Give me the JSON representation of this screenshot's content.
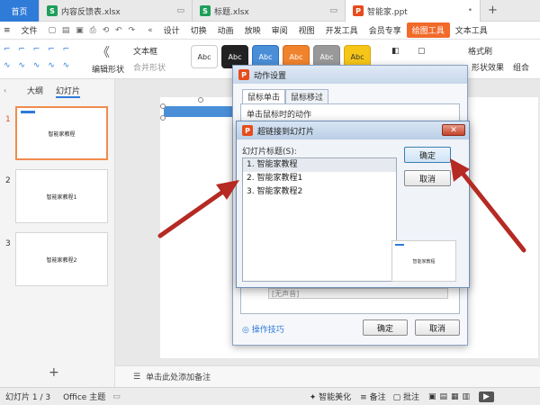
{
  "tabs": {
    "home": "首页",
    "file1": "内容反馈表.xlsx",
    "file2": "标题.xlsx",
    "file3": "智能家.ppt"
  },
  "menu": {
    "file": "文件",
    "items": [
      "设计",
      "切换",
      "动画",
      "放映",
      "审阅",
      "视图",
      "开发工具",
      "会员专享"
    ],
    "drawing_tools": "绘图工具",
    "text_tools": "文本工具"
  },
  "ribbon": {
    "edit_shape": "编辑形状",
    "text_box": "文本框",
    "merge_shape": "合并形状",
    "style_label": "Abc",
    "format_painter": "格式刷",
    "fill": "填充",
    "outline": "轮廓",
    "shape_effect": "形状效果",
    "group": "组合"
  },
  "left_pane": {
    "outline_tab": "大纲",
    "slides_tab": "幻灯片",
    "slide_titles": [
      "智能家教程",
      "智能家教程1",
      "智能家教程2"
    ],
    "slide_numbers": [
      "1",
      "2",
      "3"
    ],
    "add": "+"
  },
  "notes_placeholder": "单击此处添加备注",
  "status": {
    "slide_count": "幻灯片 1 / 3",
    "theme": "Office 主题",
    "beautify": "智能美化",
    "notes": "备注",
    "comments": "批注"
  },
  "action_dialog": {
    "title": "动作设置",
    "tab_click": "鼠标单击",
    "tab_hover": "鼠标移过",
    "section": "单击鼠标时的动作",
    "hint": "操作技巧",
    "ok": "确定",
    "cancel": "取消",
    "none_sound": "[无声音]"
  },
  "hyperlink_dialog": {
    "title": "超链接到幻灯片",
    "list_label": "幻灯片标题(S):",
    "items": [
      "1. 智能家教程",
      "2. 智能家教程1",
      "3. 智能家教程2"
    ],
    "ok": "确定",
    "cancel": "取消",
    "preview_title": "智能家教程"
  },
  "colors": {
    "accent": "#2f7bd8",
    "wps_orange": "#f26a2a",
    "arrow_red": "#b52a23"
  }
}
